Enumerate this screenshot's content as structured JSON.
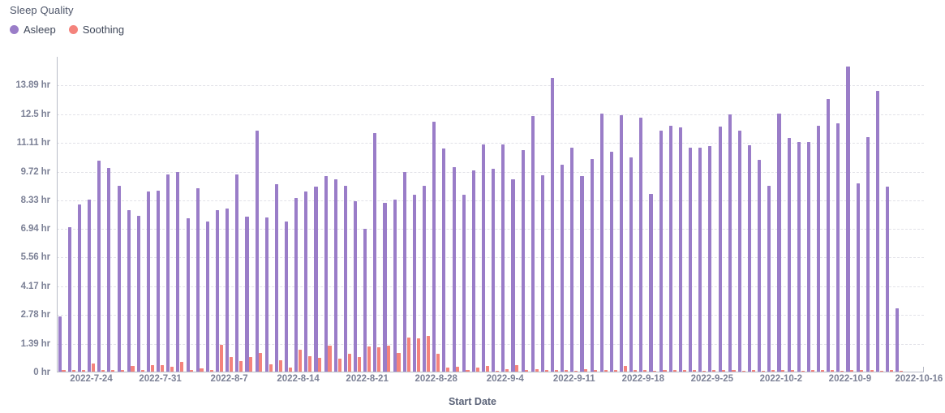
{
  "chart_title": "Sleep Quality",
  "legend": {
    "position": "top-left",
    "items": [
      {
        "label": "Asleep",
        "color": "#9a7dc8"
      },
      {
        "label": "Soothing",
        "color": "#f4837c"
      }
    ]
  },
  "axis": {
    "x_title": "Start Date",
    "y_title": "",
    "y_unit": "hr",
    "y_ticks": [
      "0 hr",
      "1.39 hr",
      "2.78 hr",
      "4.17 hr",
      "5.56 hr",
      "6.94 hr",
      "8.33 hr",
      "9.72 hr",
      "11.11 hr",
      "12.5 hr",
      "13.89 hr"
    ],
    "x_ticks": [
      "2022-7-24",
      "2022-7-31",
      "2022-8-7",
      "2022-8-14",
      "2022-8-21",
      "2022-8-28",
      "2022-9-4",
      "2022-9-11",
      "2022-9-18",
      "2022-9-25",
      "2022-10-2",
      "2022-10-9",
      "2022-10-16"
    ]
  },
  "chart_data": {
    "type": "bar",
    "title": "Sleep Quality",
    "xlabel": "Start Date",
    "ylabel": "",
    "ylim": [
      0,
      15.28
    ],
    "grid": true,
    "grid_style": "dashed-horizontal",
    "y_tick_values": [
      0,
      1.39,
      2.78,
      4.17,
      5.56,
      6.94,
      8.33,
      9.72,
      11.11,
      12.5,
      13.89
    ],
    "legend_position": "top-left",
    "categories": [
      "2022-7-21",
      "2022-7-22",
      "2022-7-23",
      "2022-7-24",
      "2022-7-25",
      "2022-7-26",
      "2022-7-27",
      "2022-7-28",
      "2022-7-29",
      "2022-7-30",
      "2022-7-31",
      "2022-8-1",
      "2022-8-2",
      "2022-8-3",
      "2022-8-4",
      "2022-8-5",
      "2022-8-6",
      "2022-8-7",
      "2022-8-8",
      "2022-8-9",
      "2022-8-10",
      "2022-8-11",
      "2022-8-12",
      "2022-8-13",
      "2022-8-14",
      "2022-8-15",
      "2022-8-16",
      "2022-8-17",
      "2022-8-18",
      "2022-8-19",
      "2022-8-20",
      "2022-8-21",
      "2022-8-22",
      "2022-8-23",
      "2022-8-24",
      "2022-8-25",
      "2022-8-26",
      "2022-8-27",
      "2022-8-28",
      "2022-8-29",
      "2022-8-30",
      "2022-8-31",
      "2022-9-1",
      "2022-9-2",
      "2022-9-3",
      "2022-9-4",
      "2022-9-5",
      "2022-9-6",
      "2022-9-7",
      "2022-9-8",
      "2022-9-9",
      "2022-9-10",
      "2022-9-11",
      "2022-9-12",
      "2022-9-13",
      "2022-9-14",
      "2022-9-15",
      "2022-9-16",
      "2022-9-17",
      "2022-9-18",
      "2022-9-19",
      "2022-9-20",
      "2022-9-21",
      "2022-9-22",
      "2022-9-23",
      "2022-9-24",
      "2022-9-25",
      "2022-9-26",
      "2022-9-27",
      "2022-9-28",
      "2022-9-29",
      "2022-9-30",
      "2022-10-1",
      "2022-10-2",
      "2022-10-3",
      "2022-10-4",
      "2022-10-5",
      "2022-10-6",
      "2022-10-7",
      "2022-10-8",
      "2022-10-9",
      "2022-10-10",
      "2022-10-11",
      "2022-10-12",
      "2022-10-13",
      "2022-10-14",
      "2022-10-15",
      "2022-10-16"
    ],
    "series": [
      {
        "name": "Asleep",
        "color": "#9a7dc8",
        "values": [
          2.7,
          7.05,
          8.15,
          8.35,
          10.25,
          9.9,
          9.05,
          7.85,
          7.6,
          8.75,
          8.8,
          9.6,
          9.7,
          7.45,
          8.9,
          7.3,
          7.85,
          7.95,
          9.6,
          7.55,
          11.7,
          7.5,
          9.1,
          7.3,
          8.45,
          8.75,
          9.0,
          9.5,
          9.35,
          9.05,
          8.3,
          6.95,
          11.6,
          8.2,
          8.35,
          9.7,
          8.6,
          9.05,
          12.15,
          10.85,
          9.95,
          8.6,
          9.8,
          11.05,
          9.85,
          11.05,
          9.35,
          10.75,
          12.4,
          9.55,
          14.25,
          10.05,
          10.9,
          9.5,
          10.35,
          12.55,
          10.7,
          12.45,
          10.4,
          12.35,
          8.65,
          11.7,
          11.95,
          11.85,
          10.9,
          10.9,
          10.95,
          11.9,
          12.5,
          11.7,
          11.0,
          10.3,
          9.05,
          12.55,
          11.35,
          11.15,
          11.15,
          11.95,
          13.25,
          12.05,
          14.8,
          9.15,
          11.4,
          13.65,
          9.0,
          3.1
        ]
      },
      {
        "name": "Soothing",
        "color": "#f4837c",
        "values": [
          0.1,
          0.1,
          0.1,
          0.45,
          0.12,
          0.1,
          0.1,
          0.3,
          0.1,
          0.35,
          0.35,
          0.28,
          0.5,
          0.1,
          0.2,
          0.1,
          1.35,
          0.75,
          0.55,
          0.75,
          0.95,
          0.4,
          0.6,
          0.25,
          1.1,
          0.8,
          0.7,
          1.3,
          0.65,
          0.9,
          0.75,
          1.25,
          1.2,
          1.3,
          0.95,
          1.7,
          1.65,
          1.75,
          0.9,
          0.25,
          0.28,
          0.1,
          0.22,
          0.3,
          0.08,
          0.15,
          0.35,
          0.1,
          0.15,
          0.1,
          0.12,
          0.1,
          0.08,
          0.15,
          0.1,
          0.12,
          0.1,
          0.3,
          0.1,
          0.1,
          0.08,
          0.12,
          0.1,
          0.12,
          0.1,
          0.08,
          0.1,
          0.12,
          0.1,
          0.08,
          0.1,
          0.08,
          0.1,
          0.12,
          0.1,
          0.08,
          0.1,
          0.12,
          0.1,
          0.08,
          0.1,
          0.12,
          0.1,
          0.08,
          0.1,
          0.08
        ]
      }
    ]
  }
}
